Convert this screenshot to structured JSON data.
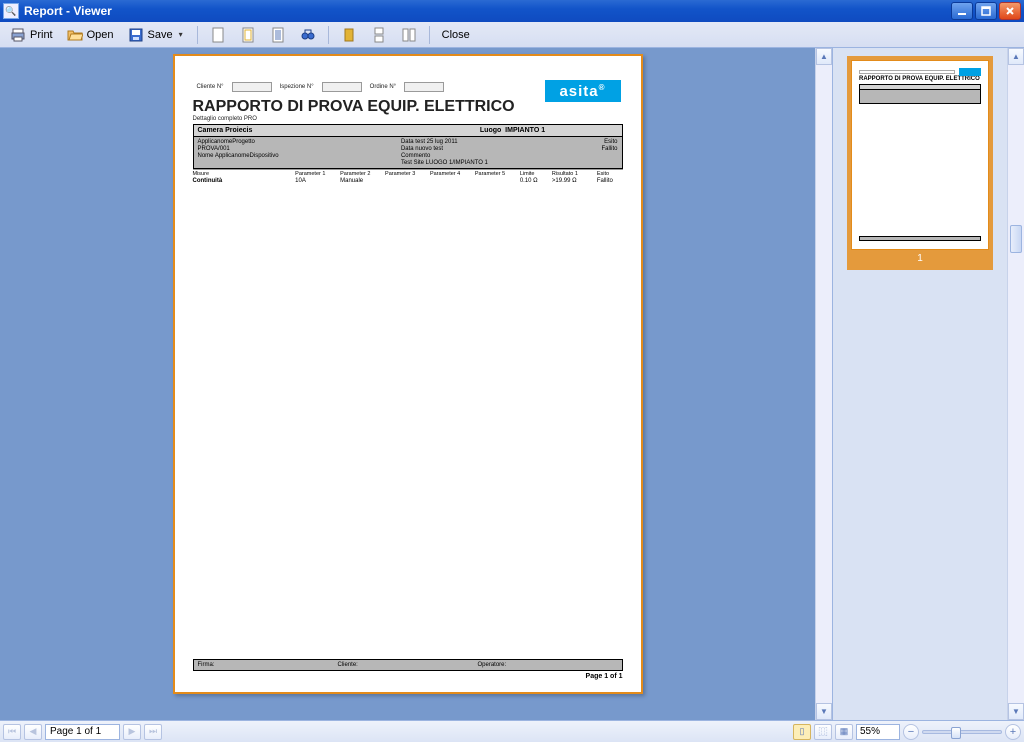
{
  "window": {
    "title": "Report - Viewer"
  },
  "toolbar": {
    "print": "Print",
    "open": "Open",
    "save": "Save",
    "close": "Close"
  },
  "report": {
    "header_fields": {
      "cliente_label": "Cliente N°",
      "ispezione_label": "Ispezione N°",
      "ordine_label": "Ordine N°"
    },
    "logo": "asita",
    "title": "RAPPORTO DI PROVA EQUIP. ELETTRICO",
    "subtitle": "Dettaglio completo PRO",
    "section": {
      "left": "Camera Proiecis",
      "right_prefix": "Luogo",
      "right_value": "IMPIANTO 1"
    },
    "meta": {
      "app_progetto_label": "ApplicanomeProgetto",
      "app_progetto_value": "PROVA/001",
      "nome_dispositivo_label": "Nome ApplicanomeDispositivo",
      "data_test_label": "Data test",
      "data_test_value": "25 lug 2011",
      "data_nuovo_label": "Data nuovo test",
      "commento_label": "Commento",
      "test_site_label": "Test Site",
      "test_site_value": "LUOGO 1/IMPIANTO 1",
      "esito_label": "Esito",
      "esito_value": "Fallito"
    },
    "table": {
      "headers": [
        "Misure",
        "Parameter 1",
        "Parameter 2",
        "Parameter 3",
        "Parameter 4",
        "Parameter 5",
        "Limite",
        "Risultato 1",
        "Esito"
      ],
      "row": {
        "name": "Continuità",
        "p1": "10A",
        "p2": "Manuale",
        "p3": "",
        "p4": "",
        "p5": "",
        "limite": "0.10 Ω",
        "ris": ">19.99 Ω",
        "esito": "Fallito"
      }
    },
    "signature": {
      "firma": "Firma:",
      "cliente": "Cliente:",
      "operatore": "Operatore:"
    },
    "page_label": "Page 1 of 1"
  },
  "thumbnail": {
    "label": "1"
  },
  "navbar": {
    "page_text": "Page 1 of 1",
    "zoom_text": "55%"
  }
}
